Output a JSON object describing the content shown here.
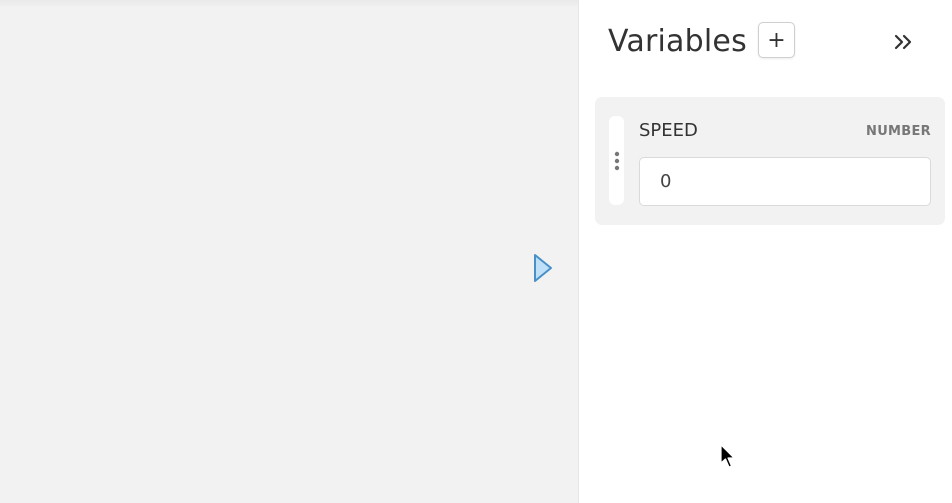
{
  "panel": {
    "title": "Variables",
    "add_label": "+",
    "collapse_icon": "double-chevron-right-icon"
  },
  "variables": [
    {
      "name": "SPEED",
      "type": "NUMBER",
      "value": "0"
    }
  ],
  "canvas": {
    "run_icon": "play-arrow-icon"
  },
  "colors": {
    "canvas_bg": "#f2f2f2",
    "card_bg": "#f2f2f2",
    "arrow_fill": "#bfe0f7",
    "arrow_stroke": "#4a90c8",
    "text": "#333333",
    "muted": "#777777"
  }
}
